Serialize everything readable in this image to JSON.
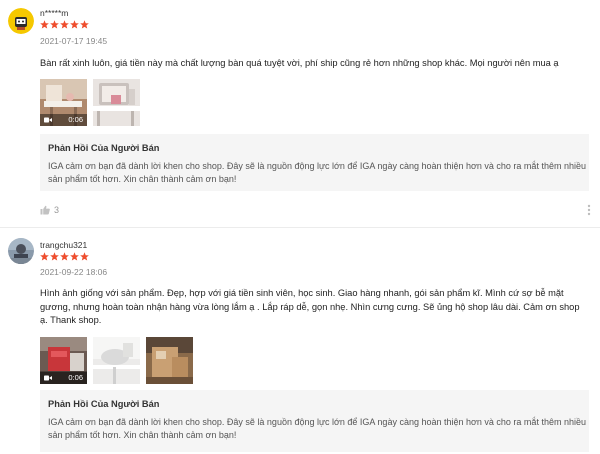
{
  "reviews": [
    {
      "author": "n*****m",
      "rating": 5,
      "date": "2021-07-17 19:45",
      "comment": "Bàn rất xinh luôn, giá tiền này mà chất lượng bàn quá tuyệt vời, phí ship cũng rẻ hơn những shop khác. Mọi người nên mua ạ",
      "media": [
        {
          "type": "video",
          "duration": "0:06"
        },
        {
          "type": "image"
        }
      ],
      "reply": {
        "title": "Phản Hồi Của Người Bán",
        "text": "IGA cảm ơn bạn đã dành lời khen cho shop. Đây sẽ là nguồn động lực lớn để IGA ngày càng hoàn thiện hơn và cho ra mắt thêm nhiều sản phẩm tốt hơn. Xin chân thành cảm ơn bạn!"
      },
      "likes": "3"
    },
    {
      "author": "trangchu321",
      "rating": 5,
      "date": "2021-09-22 18:06",
      "comment": "Hình ảnh giống với sản phẩm. Đẹp, hợp với giá tiền sinh viên, học sinh. Giao hàng nhanh, gói sản phẩm kĩ. Mình cứ sợ bễ mặt gương, nhưng hoàn toàn nhận hàng vừa lòng lắm ạ . Lắp ráp dễ, gọn nhẹ. Nhìn cưng cưng. Sẽ ủng hộ shop lâu dài. Cảm ơn shop ạ. Thank shop.",
      "media": [
        {
          "type": "video",
          "duration": "0:06"
        },
        {
          "type": "image"
        },
        {
          "type": "image"
        }
      ],
      "reply": {
        "title": "Phản Hồi Của Người Bán",
        "text": "IGA cảm ơn bạn đã dành lời khen cho shop. Đây sẽ là nguồn động lực lớn để IGA ngày càng hoàn thiện hơn và cho ra mắt thêm nhiều sản phẩm tốt hơn. Xin chân thành cảm ơn bạn!"
      }
    }
  ],
  "colors": {
    "star": "#ee4d2d",
    "reply_bg": "#f5f5f5",
    "meta_text": "#888888"
  },
  "icons": {
    "star": "star-icon",
    "camera": "video-camera-icon",
    "like": "thumbs-up-icon",
    "more": "more-options-icon"
  }
}
